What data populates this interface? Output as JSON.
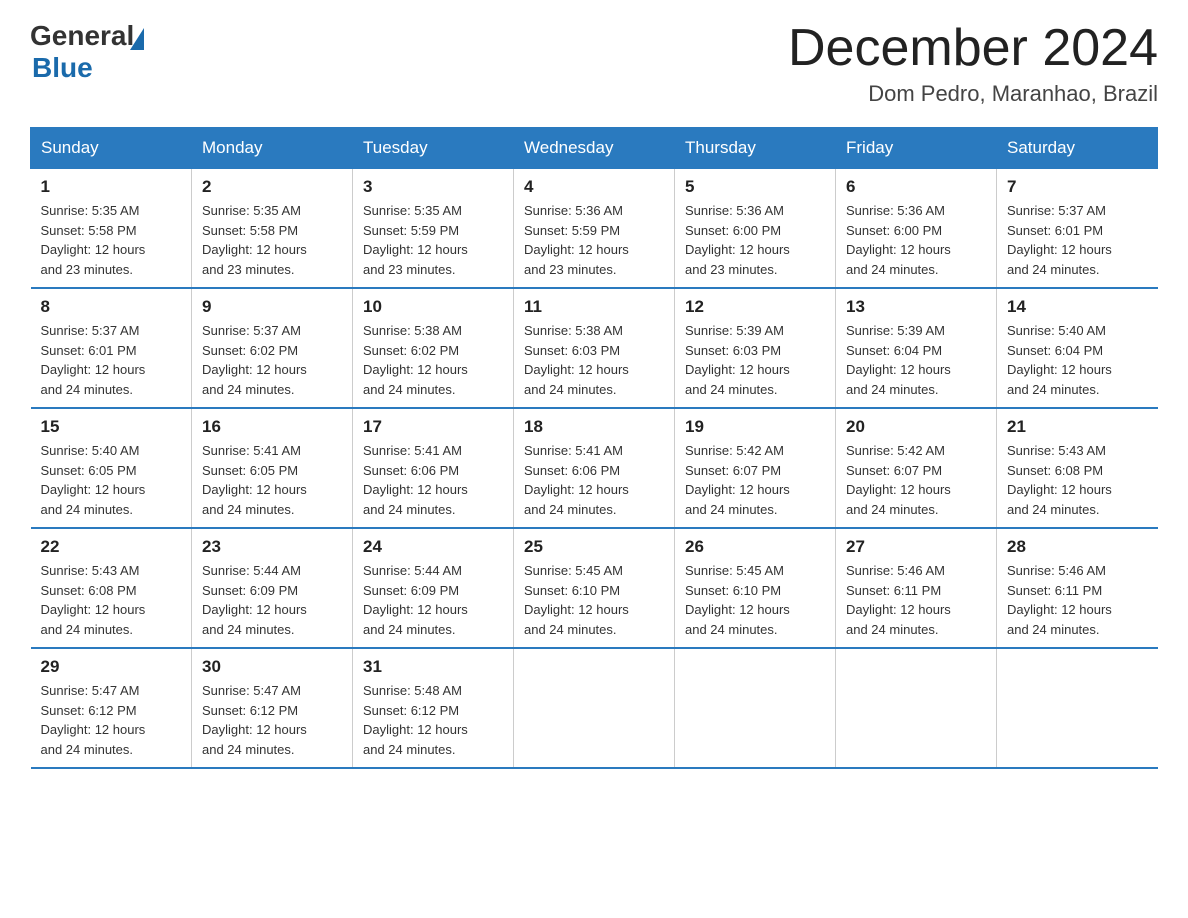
{
  "header": {
    "logo_general": "General",
    "logo_blue": "Blue",
    "month": "December 2024",
    "location": "Dom Pedro, Maranhao, Brazil"
  },
  "days_of_week": [
    "Sunday",
    "Monday",
    "Tuesday",
    "Wednesday",
    "Thursday",
    "Friday",
    "Saturday"
  ],
  "weeks": [
    [
      {
        "day": "1",
        "sunrise": "5:35 AM",
        "sunset": "5:58 PM",
        "daylight": "12 hours and 23 minutes."
      },
      {
        "day": "2",
        "sunrise": "5:35 AM",
        "sunset": "5:58 PM",
        "daylight": "12 hours and 23 minutes."
      },
      {
        "day": "3",
        "sunrise": "5:35 AM",
        "sunset": "5:59 PM",
        "daylight": "12 hours and 23 minutes."
      },
      {
        "day": "4",
        "sunrise": "5:36 AM",
        "sunset": "5:59 PM",
        "daylight": "12 hours and 23 minutes."
      },
      {
        "day": "5",
        "sunrise": "5:36 AM",
        "sunset": "6:00 PM",
        "daylight": "12 hours and 23 minutes."
      },
      {
        "day": "6",
        "sunrise": "5:36 AM",
        "sunset": "6:00 PM",
        "daylight": "12 hours and 24 minutes."
      },
      {
        "day": "7",
        "sunrise": "5:37 AM",
        "sunset": "6:01 PM",
        "daylight": "12 hours and 24 minutes."
      }
    ],
    [
      {
        "day": "8",
        "sunrise": "5:37 AM",
        "sunset": "6:01 PM",
        "daylight": "12 hours and 24 minutes."
      },
      {
        "day": "9",
        "sunrise": "5:37 AM",
        "sunset": "6:02 PM",
        "daylight": "12 hours and 24 minutes."
      },
      {
        "day": "10",
        "sunrise": "5:38 AM",
        "sunset": "6:02 PM",
        "daylight": "12 hours and 24 minutes."
      },
      {
        "day": "11",
        "sunrise": "5:38 AM",
        "sunset": "6:03 PM",
        "daylight": "12 hours and 24 minutes."
      },
      {
        "day": "12",
        "sunrise": "5:39 AM",
        "sunset": "6:03 PM",
        "daylight": "12 hours and 24 minutes."
      },
      {
        "day": "13",
        "sunrise": "5:39 AM",
        "sunset": "6:04 PM",
        "daylight": "12 hours and 24 minutes."
      },
      {
        "day": "14",
        "sunrise": "5:40 AM",
        "sunset": "6:04 PM",
        "daylight": "12 hours and 24 minutes."
      }
    ],
    [
      {
        "day": "15",
        "sunrise": "5:40 AM",
        "sunset": "6:05 PM",
        "daylight": "12 hours and 24 minutes."
      },
      {
        "day": "16",
        "sunrise": "5:41 AM",
        "sunset": "6:05 PM",
        "daylight": "12 hours and 24 minutes."
      },
      {
        "day": "17",
        "sunrise": "5:41 AM",
        "sunset": "6:06 PM",
        "daylight": "12 hours and 24 minutes."
      },
      {
        "day": "18",
        "sunrise": "5:41 AM",
        "sunset": "6:06 PM",
        "daylight": "12 hours and 24 minutes."
      },
      {
        "day": "19",
        "sunrise": "5:42 AM",
        "sunset": "6:07 PM",
        "daylight": "12 hours and 24 minutes."
      },
      {
        "day": "20",
        "sunrise": "5:42 AM",
        "sunset": "6:07 PM",
        "daylight": "12 hours and 24 minutes."
      },
      {
        "day": "21",
        "sunrise": "5:43 AM",
        "sunset": "6:08 PM",
        "daylight": "12 hours and 24 minutes."
      }
    ],
    [
      {
        "day": "22",
        "sunrise": "5:43 AM",
        "sunset": "6:08 PM",
        "daylight": "12 hours and 24 minutes."
      },
      {
        "day": "23",
        "sunrise": "5:44 AM",
        "sunset": "6:09 PM",
        "daylight": "12 hours and 24 minutes."
      },
      {
        "day": "24",
        "sunrise": "5:44 AM",
        "sunset": "6:09 PM",
        "daylight": "12 hours and 24 minutes."
      },
      {
        "day": "25",
        "sunrise": "5:45 AM",
        "sunset": "6:10 PM",
        "daylight": "12 hours and 24 minutes."
      },
      {
        "day": "26",
        "sunrise": "5:45 AM",
        "sunset": "6:10 PM",
        "daylight": "12 hours and 24 minutes."
      },
      {
        "day": "27",
        "sunrise": "5:46 AM",
        "sunset": "6:11 PM",
        "daylight": "12 hours and 24 minutes."
      },
      {
        "day": "28",
        "sunrise": "5:46 AM",
        "sunset": "6:11 PM",
        "daylight": "12 hours and 24 minutes."
      }
    ],
    [
      {
        "day": "29",
        "sunrise": "5:47 AM",
        "sunset": "6:12 PM",
        "daylight": "12 hours and 24 minutes."
      },
      {
        "day": "30",
        "sunrise": "5:47 AM",
        "sunset": "6:12 PM",
        "daylight": "12 hours and 24 minutes."
      },
      {
        "day": "31",
        "sunrise": "5:48 AM",
        "sunset": "6:12 PM",
        "daylight": "12 hours and 24 minutes."
      },
      null,
      null,
      null,
      null
    ]
  ],
  "labels": {
    "sunrise": "Sunrise:",
    "sunset": "Sunset:",
    "daylight": "Daylight:"
  }
}
